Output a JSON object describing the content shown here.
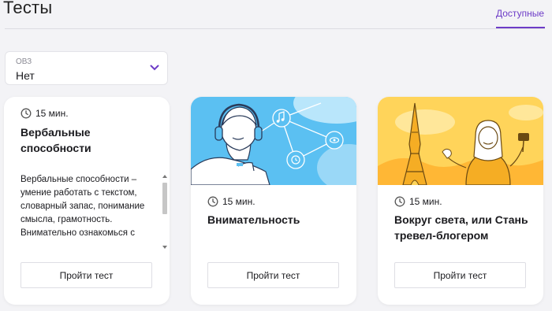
{
  "header": {
    "title": "Тесты",
    "tab_active": "Доступные"
  },
  "filter": {
    "label": "ОВЗ",
    "value": "Нет"
  },
  "cards": [
    {
      "duration": "15 мин.",
      "title": "Вербальные способности",
      "description": "Вербальные способности – умение работать с текстом, словарный запас, понимание смысла, грамотность. Внимательно ознакомься с",
      "button": "Пройти тест"
    },
    {
      "duration": "15 мин.",
      "title": "Внимательность",
      "button": "Пройти тест"
    },
    {
      "duration": "15 мин.",
      "title": "Вокруг света, или Стань тревел-блогером",
      "button": "Пройти тест"
    }
  ],
  "colors": {
    "accent": "#6d3cc7",
    "card2_bg": "#5bc0f2",
    "card3_bg": "#ffd45a"
  }
}
